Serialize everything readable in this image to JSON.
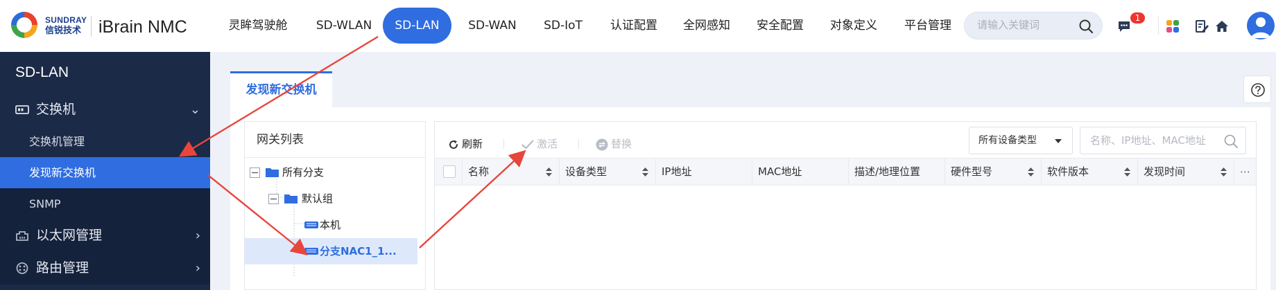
{
  "header": {
    "brand_en": "SUNDRAY",
    "brand_cn": "信锐技术",
    "product": "iBrain NMC",
    "nav": [
      {
        "label": "灵眸驾驶舱",
        "active": false
      },
      {
        "label": "SD-WLAN",
        "active": false
      },
      {
        "label": "SD-LAN",
        "active": true
      },
      {
        "label": "SD-WAN",
        "active": false
      },
      {
        "label": "SD-IoT",
        "active": false
      },
      {
        "label": "认证配置",
        "active": false
      },
      {
        "label": "全网感知",
        "active": false
      },
      {
        "label": "安全配置",
        "active": false
      },
      {
        "label": "对象定义",
        "active": false
      },
      {
        "label": "平台管理",
        "active": false
      }
    ],
    "search_placeholder": "请输入关键词",
    "message_badge": "1",
    "icons": [
      "message-icon",
      "apps-icon",
      "edit-icon",
      "home-icon",
      "avatar"
    ]
  },
  "sidebar": {
    "title": "SD-LAN",
    "groups": [
      {
        "label": "交换机",
        "expanded": true,
        "icon": "switch-icon"
      },
      {
        "label": "以太网管理",
        "expanded": false,
        "icon": "ethernet-icon"
      },
      {
        "label": "路由管理",
        "expanded": false,
        "icon": "route-icon"
      }
    ],
    "items": [
      {
        "label": "交换机管理",
        "active": false
      },
      {
        "label": "发现新交换机",
        "active": true
      },
      {
        "label": "SNMP",
        "active": false
      }
    ]
  },
  "main": {
    "tab": "发现新交换机",
    "tree": {
      "title": "网关列表",
      "nodes": [
        {
          "label": "所有分支",
          "type": "folder"
        },
        {
          "label": "默认组",
          "type": "folder"
        },
        {
          "label": "本机",
          "type": "device"
        },
        {
          "label": "分支NAC1_1...",
          "type": "device",
          "selected": true
        }
      ]
    },
    "toolbar": {
      "refresh": "刷新",
      "activate": "激活",
      "replace": "替换",
      "type_select": "所有设备类型",
      "search_placeholder": "名称、IP地址、MAC地址"
    },
    "columns": [
      "名称",
      "设备类型",
      "IP地址",
      "MAC地址",
      "描述/地理位置",
      "硬件型号",
      "软件版本",
      "发现时间"
    ],
    "more": "⋯"
  },
  "colors": {
    "accent": "#2f6de0",
    "sidebar_bg": "#1b2a47",
    "annotation_arrow": "#e8453c"
  }
}
